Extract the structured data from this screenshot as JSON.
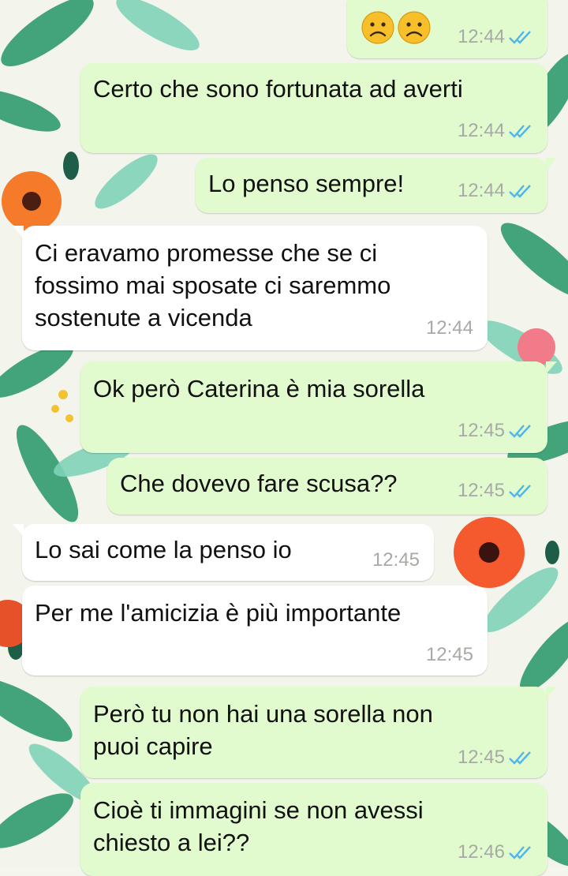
{
  "chat": {
    "messages": [
      {
        "id": "m0",
        "direction": "outgoing",
        "text": "",
        "emoji": [
          "frowning-face",
          "frowning-face"
        ],
        "time": "12:44",
        "status": "read"
      },
      {
        "id": "m1",
        "direction": "outgoing",
        "text": "Certo che sono fortunata ad averti",
        "time": "12:44",
        "status": "read"
      },
      {
        "id": "m2",
        "direction": "outgoing",
        "text": "Lo penso sempre!",
        "time": "12:44",
        "status": "read"
      },
      {
        "id": "m3",
        "direction": "incoming",
        "text": "Ci eravamo promesse che se ci\nfossimo mai sposate ci saremmo\nsostenute a vicenda",
        "time": "12:44"
      },
      {
        "id": "m4",
        "direction": "outgoing",
        "text": "Ok però Caterina è mia sorella",
        "time": "12:45",
        "status": "read"
      },
      {
        "id": "m5",
        "direction": "outgoing",
        "text": "Che dovevo fare scusa??",
        "time": "12:45",
        "status": "read"
      },
      {
        "id": "m6",
        "direction": "incoming",
        "text": "Lo sai come la penso io",
        "time": "12:45"
      },
      {
        "id": "m7",
        "direction": "incoming",
        "text": "Per me l'amicizia è più importante",
        "time": "12:45"
      },
      {
        "id": "m8",
        "direction": "outgoing",
        "text": "Però tu non hai una sorella non\npuoi capire",
        "time": "12:45",
        "status": "read"
      },
      {
        "id": "m9",
        "direction": "outgoing",
        "text": "Cioè ti immagini se non avessi\nchiesto a lei??",
        "time": "12:46",
        "status": "read"
      }
    ]
  },
  "colors": {
    "outgoing_bubble": "#e1fbcf",
    "incoming_bubble": "#ffffff",
    "timestamp": "#a7aaa4",
    "read_ticks": "#4fb6ec"
  }
}
